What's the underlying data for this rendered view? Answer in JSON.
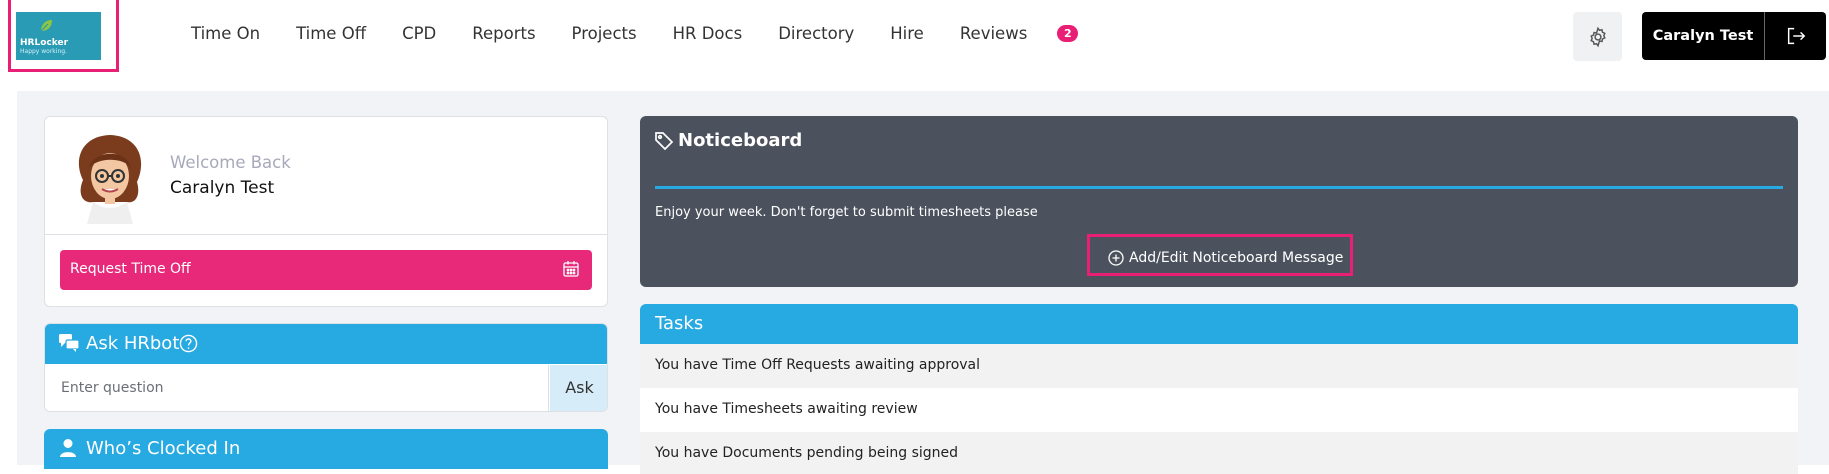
{
  "logo": {
    "name": "HRLocker",
    "tagline": "Happy working."
  },
  "nav": {
    "items": [
      "Time On",
      "Time Off",
      "CPD",
      "Reports",
      "Projects",
      "HR Docs",
      "Directory",
      "Hire",
      "Reviews"
    ],
    "badge": "2"
  },
  "user": {
    "name": "Caralyn Test"
  },
  "welcome": {
    "greeting": "Welcome Back",
    "name": "Caralyn Test",
    "request_button": "Request Time Off"
  },
  "hrbot": {
    "title": "Ask HRbot",
    "input_placeholder": "Enter question",
    "ask_label": "Ask"
  },
  "clocked": {
    "title": "Who’s Clocked In"
  },
  "noticeboard": {
    "title": "Noticeboard",
    "message": "Enjoy your week. Don't forget to submit timesheets please",
    "edit_label": "Add/Edit Noticeboard Message"
  },
  "tasks": {
    "title": "Tasks",
    "items": [
      "You have Time Off Requests awaiting approval",
      "You have Timesheets awaiting review",
      "You have Documents pending being signed"
    ]
  },
  "colors": {
    "accent_pink": "#e8297a",
    "accent_blue": "#27a9e1",
    "noticeboard_bg": "#4b525d",
    "logo_teal": "#2a9bb5"
  },
  "icons": [
    "leaf-icon",
    "gear-icon",
    "logout-icon",
    "calendar-icon",
    "chat-icon",
    "help-circle-icon",
    "user-icon",
    "tag-icon",
    "plus-circle-icon"
  ]
}
